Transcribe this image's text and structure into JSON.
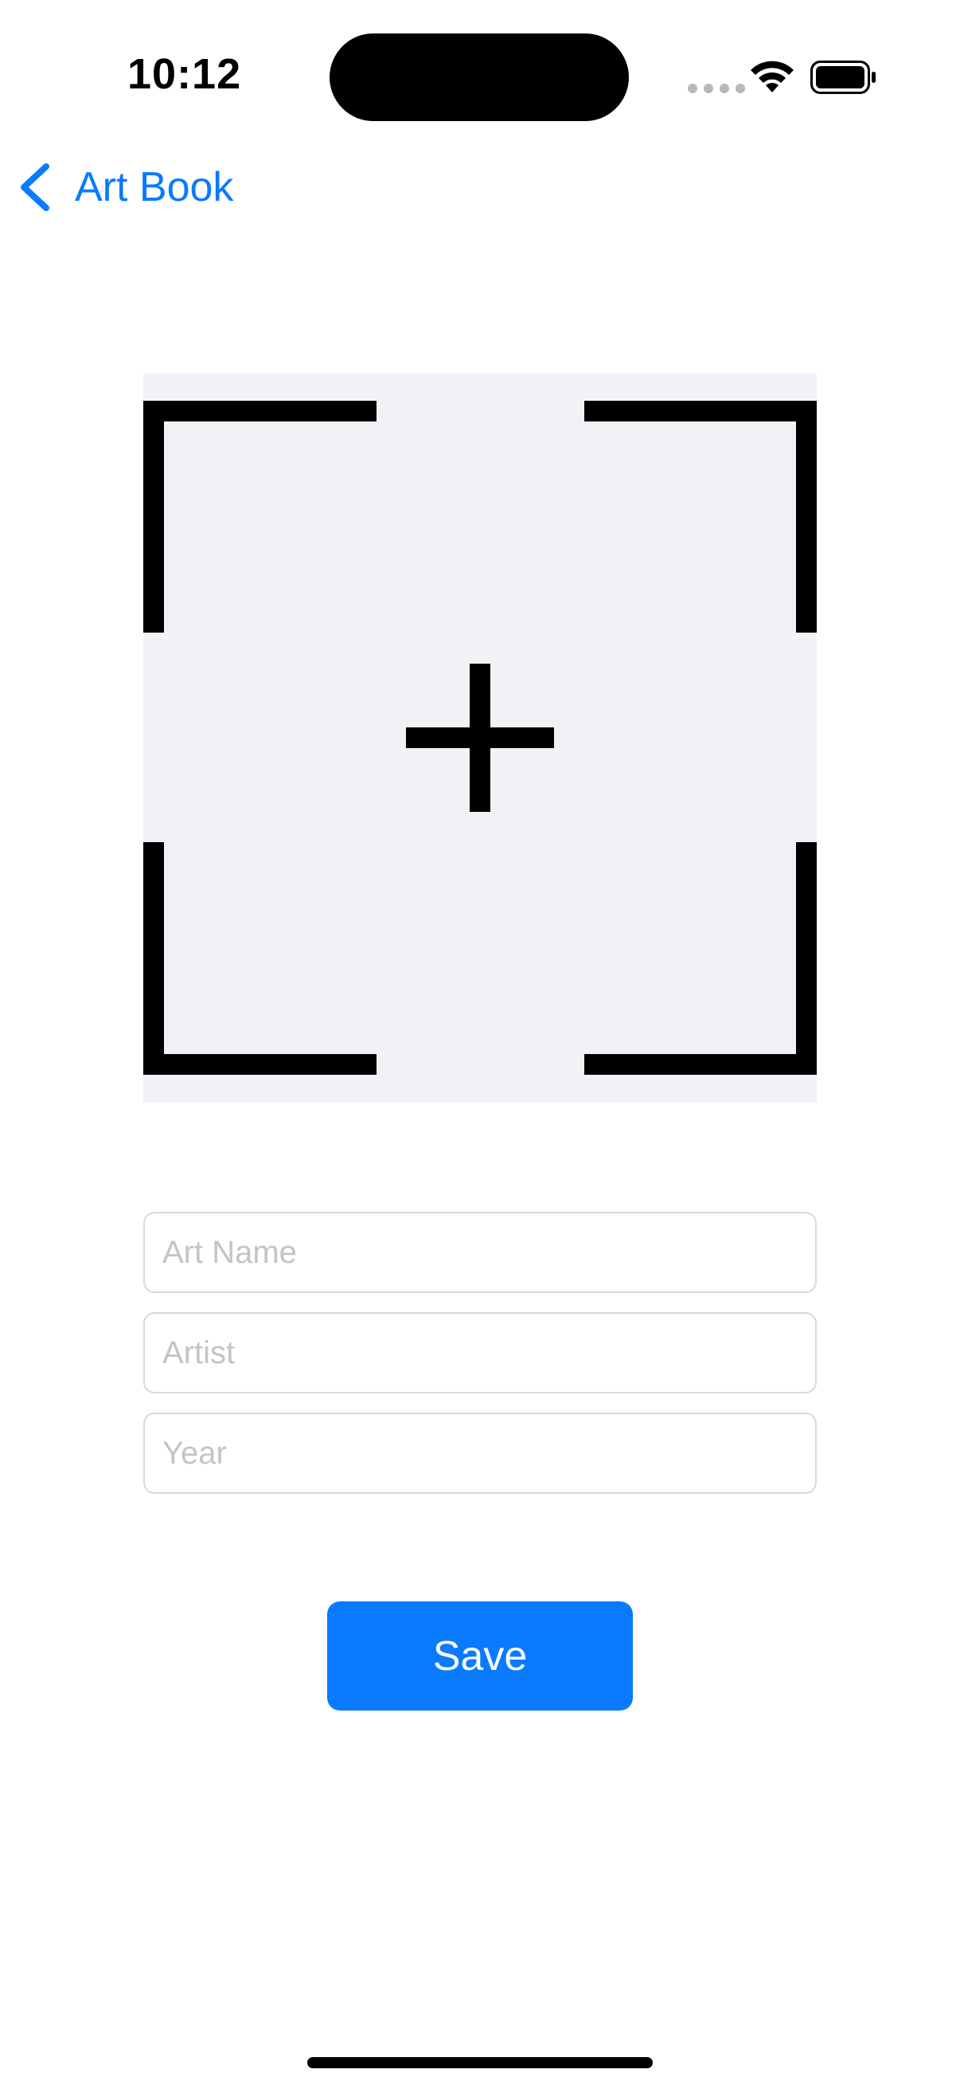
{
  "status_bar": {
    "time": "10:12",
    "icons": [
      "cellular-signal-icon",
      "wifi-icon",
      "battery-icon"
    ]
  },
  "nav": {
    "back_label": "Art Book",
    "back_icon": "chevron-left-icon"
  },
  "image_picker": {
    "icon": "add-photo-icon"
  },
  "form": {
    "art_name_placeholder": "Art Name",
    "art_name_value": "",
    "artist_placeholder": "Artist",
    "artist_value": "",
    "year_placeholder": "Year",
    "year_value": ""
  },
  "actions": {
    "save_label": "Save"
  },
  "colors": {
    "accent": "#0a7aff",
    "picker_background": "#f2f2f6",
    "placeholder": "#c4c4c7"
  }
}
